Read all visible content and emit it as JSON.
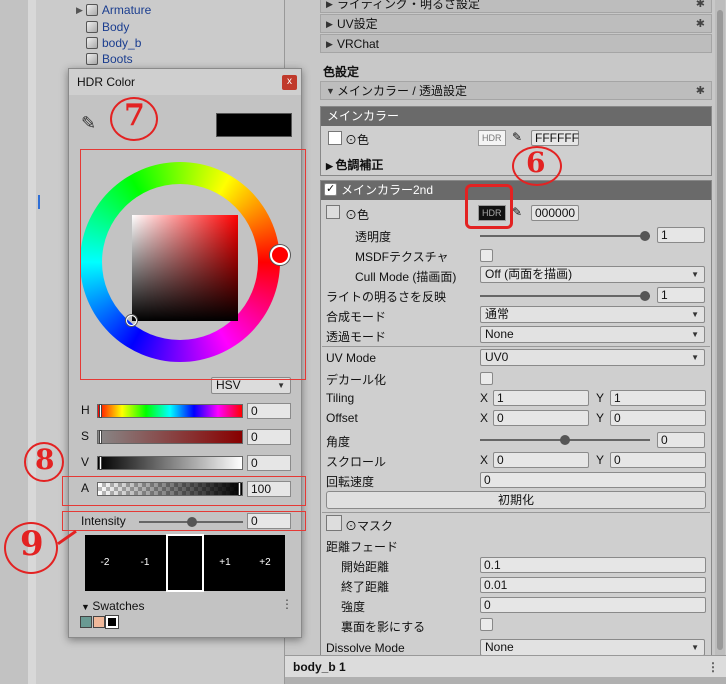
{
  "hierarchy": {
    "items": [
      {
        "label": "Armature",
        "expandable": true
      },
      {
        "label": "Body",
        "expandable": false
      },
      {
        "label": "body_b",
        "expandable": false
      },
      {
        "label": "Boots",
        "expandable": false
      }
    ]
  },
  "inspector": {
    "top_sections": [
      "ライティング・明るさ設定",
      "UV設定",
      "VRChat"
    ],
    "color_settings_label": "色設定",
    "main_color_header": "メインカラー / 透過設定",
    "main_color": {
      "title": "メインカラー",
      "color_label": "色",
      "hdr": "HDR",
      "hex": "FFFFFF",
      "tone_label": "色調補正"
    },
    "main_color_2nd": {
      "title": "メインカラー2nd",
      "color_label": "色",
      "hdr": "HDR",
      "hex": "000000",
      "opacity_label": "透明度",
      "opacity_value": "1",
      "msdf_label": "MSDFテクスチャ",
      "cull_label": "Cull Mode (描画面)",
      "cull_value": "Off (両面を描画)",
      "light_label": "ライトの明るさを反映",
      "light_value": "1",
      "blend_label": "合成モード",
      "blend_value": "通常",
      "alpha_label": "透過モード",
      "alpha_value": "None",
      "uvmode_label": "UV Mode",
      "uvmode_value": "UV0",
      "decal_label": "デカール化",
      "tiling_label": "Tiling",
      "tiling_x": "1",
      "tiling_y": "1",
      "offset_label": "Offset",
      "offset_x": "0",
      "offset_y": "0",
      "angle_label": "角度",
      "angle_value": "0",
      "scroll_label": "スクロール",
      "scroll_x": "0",
      "scroll_y": "0",
      "rot_label": "回転速度",
      "rot_value": "0",
      "reset_label": "初期化",
      "mask_label": "マスク",
      "dist_fade_label": "距離フェード",
      "start_label": "開始距離",
      "start_value": "0.1",
      "end_label": "終了距離",
      "end_value": "0.01",
      "strength_label": "強度",
      "strength_value": "0",
      "backface_label": "裏面を影にする",
      "dissolve_label": "Dissolve Mode",
      "dissolve_value": "None"
    },
    "x_label": "X",
    "y_label": "Y",
    "footer": "body_b 1"
  },
  "picker": {
    "title": "HDR Color",
    "close": "x",
    "mode": "HSV",
    "h_label": "H",
    "h_value": "0",
    "s_label": "S",
    "s_value": "0",
    "v_label": "V",
    "v_value": "0",
    "a_label": "A",
    "a_value": "100",
    "intensity_label": "Intensity",
    "intensity_value": "0",
    "exposure_labels": [
      "-2",
      "-1",
      "+1",
      "+2"
    ],
    "swatches_label": "Swatches",
    "current_color": "#000000"
  },
  "annotations": {
    "n6": "6",
    "n7": "7",
    "n8": "8",
    "n9": "9"
  },
  "colors": {
    "annotation": "#e32222",
    "selection_blue": "#2f6fd6"
  }
}
